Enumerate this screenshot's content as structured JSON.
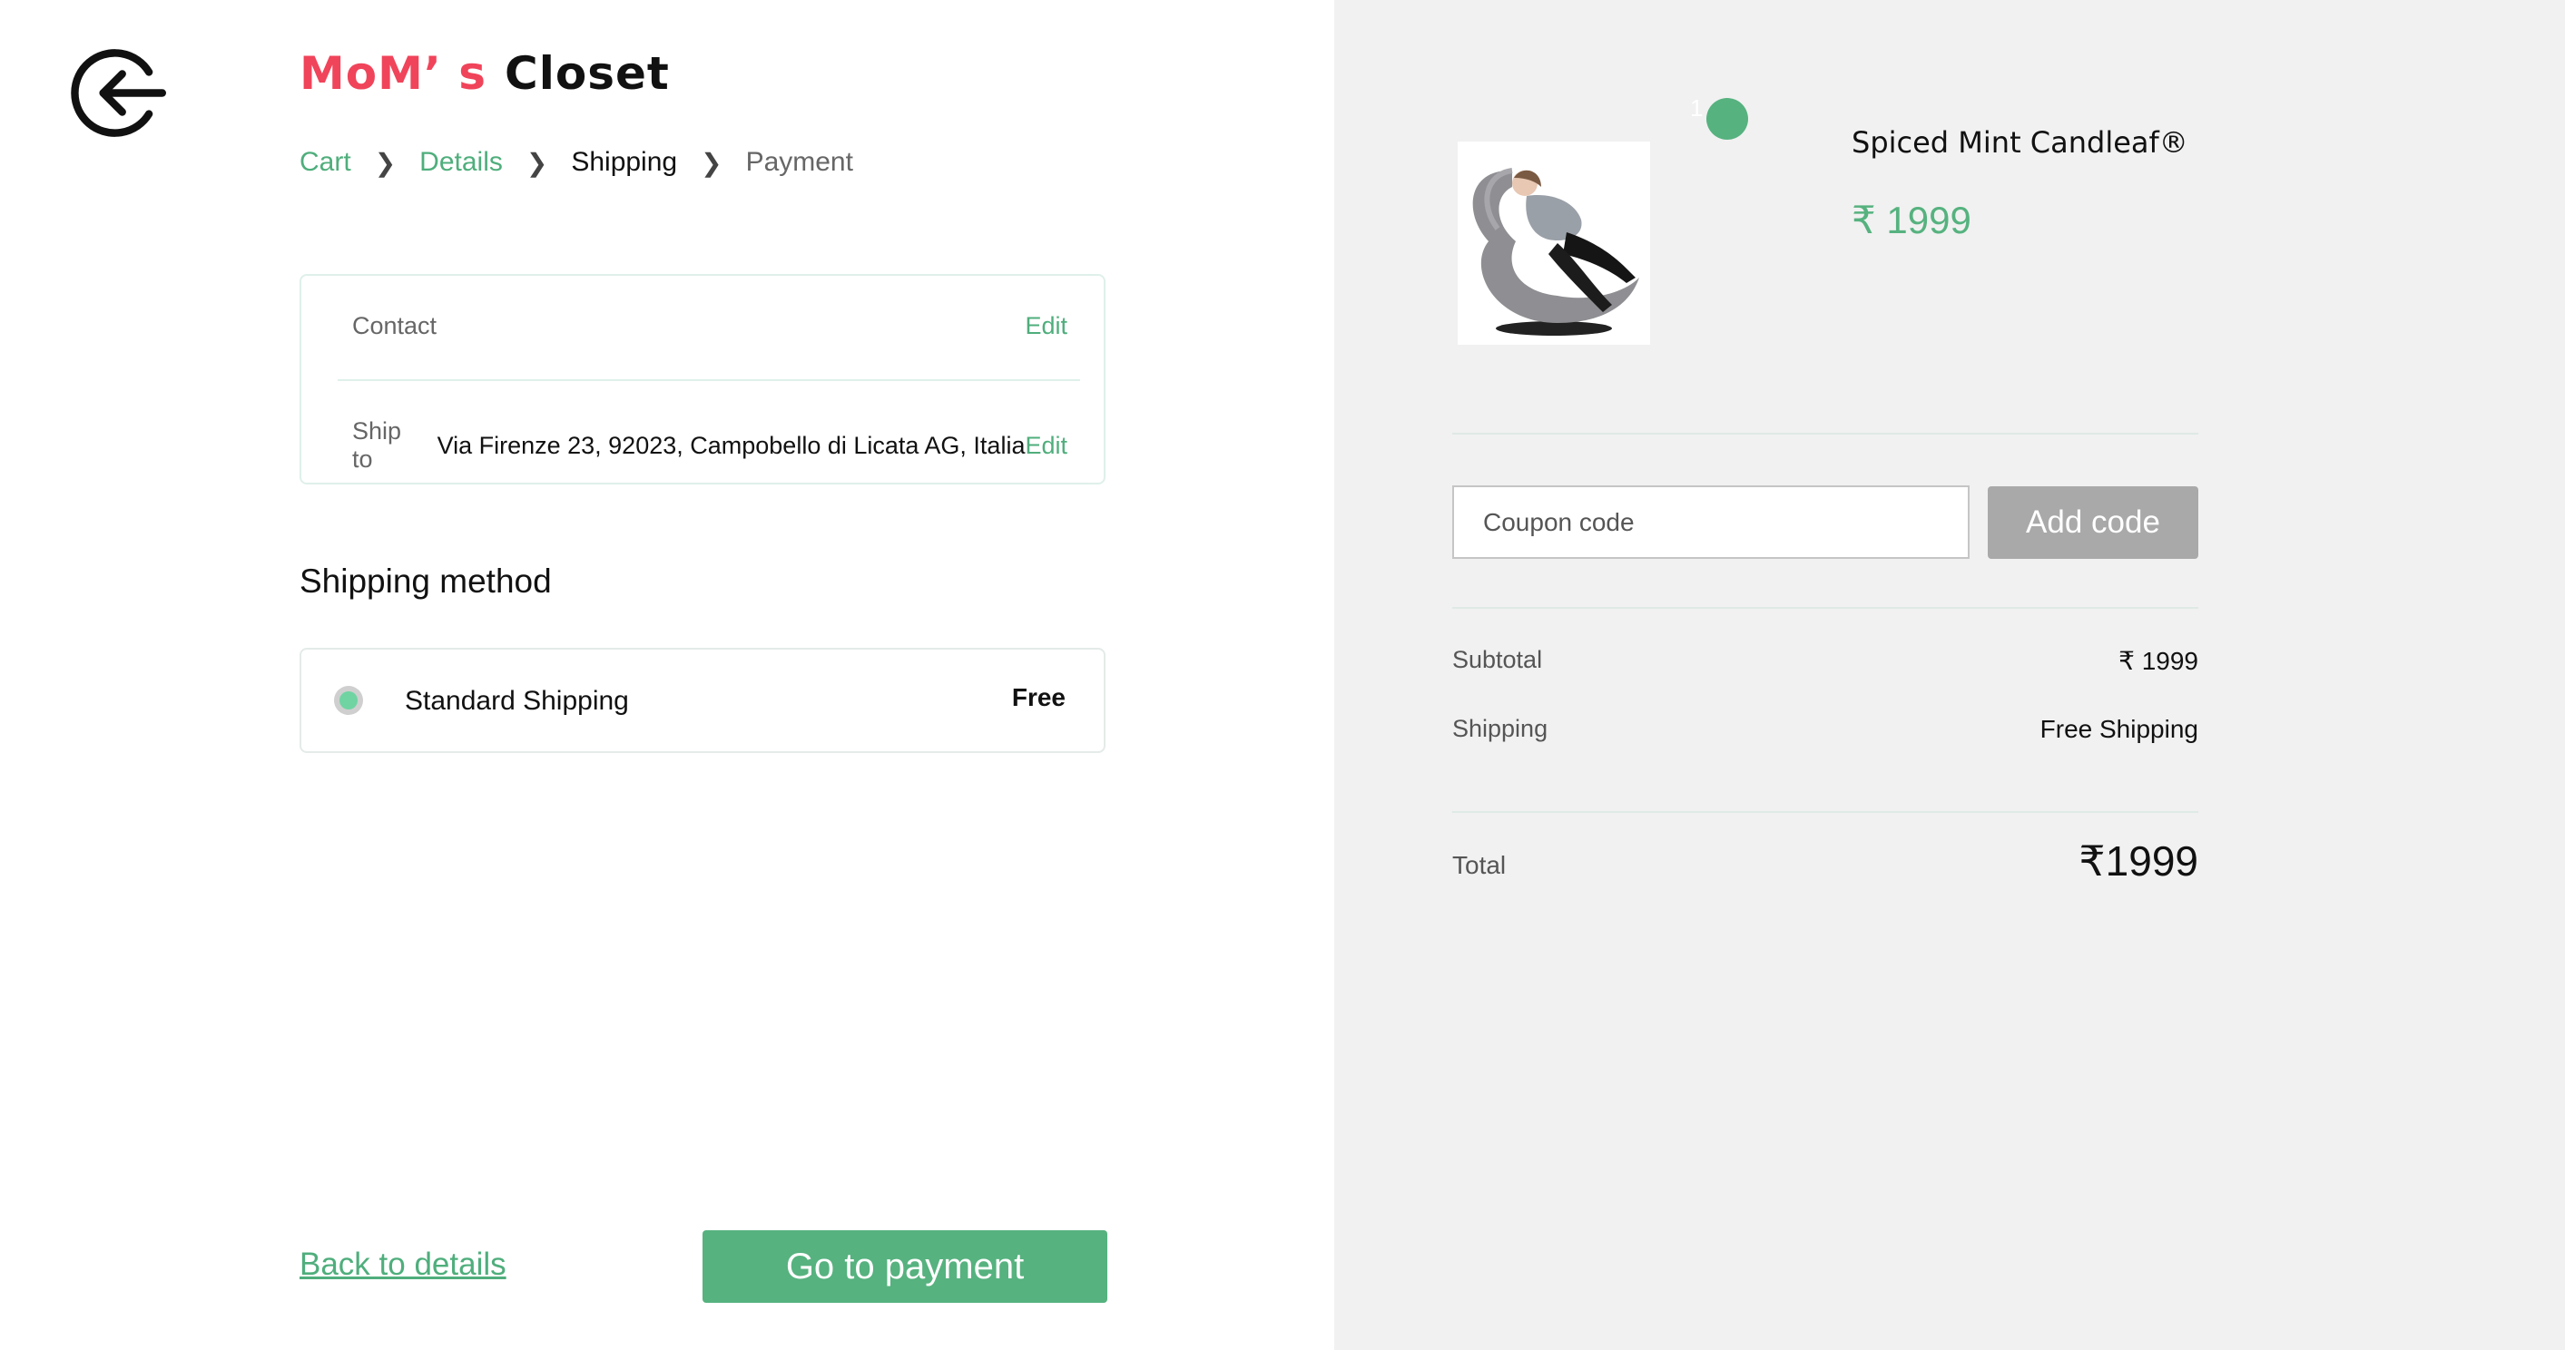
{
  "brand": {
    "part1": "MoM’ s",
    "part2": "Closet"
  },
  "breadcrumb": [
    "Cart",
    "Details",
    "Shipping",
    "Payment"
  ],
  "contact": {
    "label": "Contact",
    "edit": "Edit"
  },
  "ship_to": {
    "label": "Ship to",
    "value": "Via Firenze 23, 92023, Campobello di  Licata AG, Italia",
    "edit": "Edit"
  },
  "shipping_method": {
    "title": "Shipping method",
    "option_name": "Standard Shipping",
    "option_price": "Free"
  },
  "actions": {
    "back": "Back to details",
    "pay": "Go to payment"
  },
  "product": {
    "name": "Spiced Mint Candleaf®",
    "price": "₹ 1999",
    "qty": "1"
  },
  "coupon": {
    "placeholder": "Coupon code",
    "button": "Add code"
  },
  "summary": {
    "subtotal_label": "Subtotal",
    "subtotal_value": "₹ 1999",
    "shipping_label": "Shipping",
    "shipping_value": "Free Shipping",
    "total_label": "Total",
    "total_value": "₹1999"
  },
  "colors": {
    "brand_red": "#f0445a",
    "accent_green": "#56b27f",
    "panel_grey": "#f1f1f1"
  },
  "icons": {
    "back": "arrow-left-circle-icon",
    "breadcrumb_sep": "chevron-right-icon"
  }
}
